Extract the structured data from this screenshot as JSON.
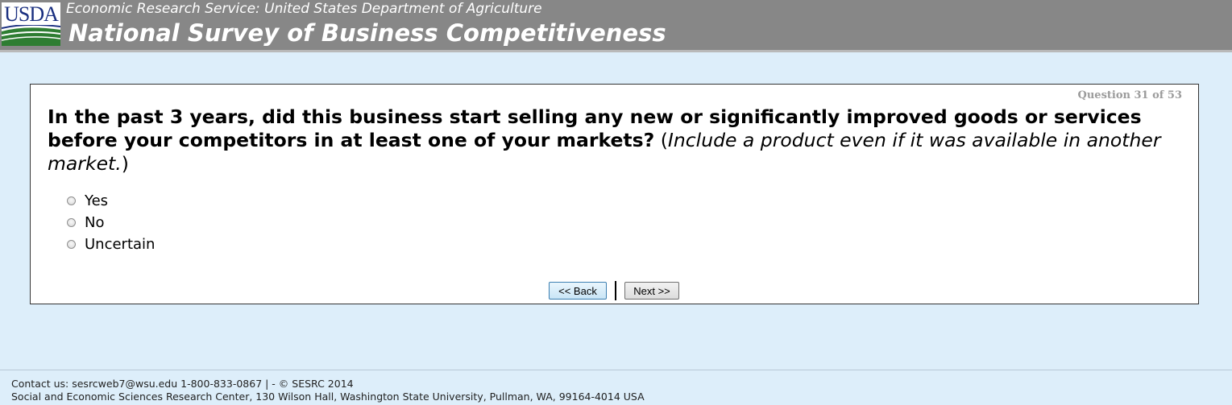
{
  "header": {
    "logo_text": "USDA",
    "subtitle": "Economic Research Service: United States Department of Agriculture",
    "title": "National Survey of Business Competitiveness"
  },
  "question": {
    "counter": "Question 31 of 53",
    "text_main": "In the past 3 years, did this business start selling any new or significantly improved goods or services before your competitors in at least one of your markets?",
    "text_open": " (",
    "text_note": "Include a product even if it was available in another market.",
    "text_close": ")",
    "options": [
      {
        "label": "Yes",
        "selected": false
      },
      {
        "label": "No",
        "selected": false
      },
      {
        "label": "Uncertain",
        "selected": false
      }
    ]
  },
  "nav": {
    "back_label": "<< Back",
    "next_label": "Next >>"
  },
  "footer": {
    "contact": "Contact us: sesrcweb7@wsu.edu 1-800-833-0867 | - © SESRC 2014",
    "address": "Social and Economic Sciences Research Center, 130 Wilson Hall, Washington State University, Pullman, WA, 99164-4014 USA"
  },
  "colors": {
    "header_bg": "#878787",
    "page_bg": "#ddeefa",
    "logo_blue": "#1a2f80",
    "logo_green": "#2e7d32"
  }
}
